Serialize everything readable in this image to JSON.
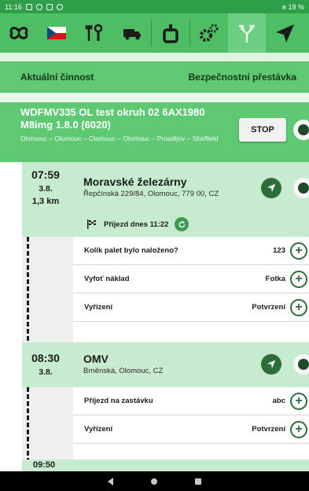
{
  "status_bar": {
    "time": "11:16",
    "battery": "ʀ 19 %"
  },
  "toolbar": {
    "icons": [
      "pretzel-icon",
      "czech-flag-icon",
      "tools-icon",
      "truck-icon",
      "box-icon",
      "gears-icon",
      "fork-arrow-icon",
      "navigation-icon"
    ]
  },
  "activity_bar": {
    "left_label": "Aktuální činnost",
    "right_label": "Bezpečnostní přestávka"
  },
  "trip": {
    "title": "WDFMV335 OL test okruh 02 6AX1980 M8img 1.8.0 (6020)",
    "route": "Olomouc – Olomouc – Olomouc – Olomouc – Prostějov – Sheffield",
    "stop_label": "STOP"
  },
  "stops": [
    {
      "time": "07:59",
      "date": "3.8.",
      "distance": "1,3 km",
      "name": "Moravské železárny",
      "address": "Řepčínská 229/84, Olomouc, 779 00, CZ",
      "arrival": "Příjezd dnes 11:22",
      "tasks": [
        {
          "label": "Kolik palet bylo naloženo?",
          "value": "123"
        },
        {
          "label": "Vyfoť náklad",
          "value": "Fotka"
        },
        {
          "label": "Vyřízení",
          "value": "Potvrzení"
        }
      ]
    },
    {
      "time": "08:30",
      "date": "3.8.",
      "name": "OMV",
      "address": "Brněnská, Olomouc, CZ",
      "tasks": [
        {
          "label": "Příjezd na zastávku",
          "value": "abc"
        },
        {
          "label": "Vyřízení",
          "value": "Potvrzení"
        }
      ]
    }
  ],
  "peek_time": "09:50",
  "colors": {
    "primary": "#4dbe63",
    "dark": "#2d6e3a",
    "light": "#c6ebce"
  }
}
